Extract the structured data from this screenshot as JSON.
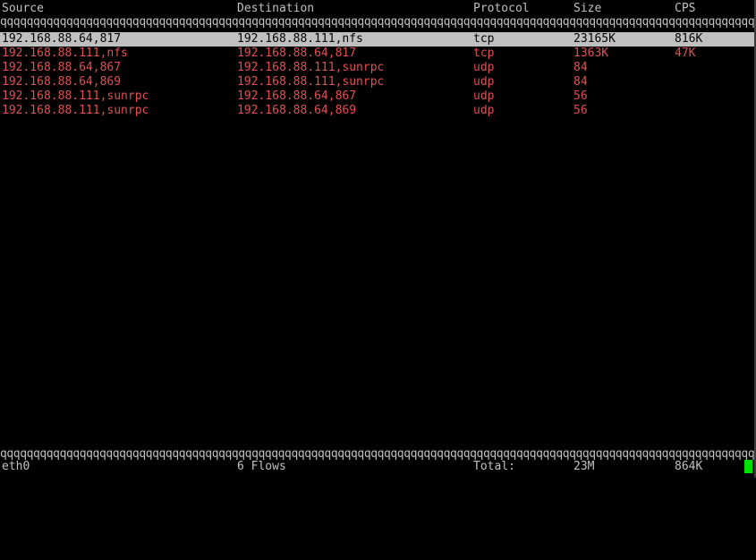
{
  "columns": {
    "source": "Source",
    "destination": "Destination",
    "protocol": "Protocol",
    "size": "Size",
    "cps": "CPS"
  },
  "separator_glyphs": "qqqqqqqqqqqqqqqqqqqqqqqqqqqqqqqqqqqqqqqqqqqqqqqqqqqqqqqqqqqqqqqqqqqqqqqqqqqqqqqqqqqqqqqqqqqqqqqqqqqqqqqqqqqqqqqqqqqqqqqqqqqqqqqqqqqqqqqqqqqq",
  "flows": [
    {
      "source": "192.168.88.64,817",
      "destination": "192.168.88.111,nfs",
      "protocol": "tcp",
      "size": "23165K",
      "cps": "816K",
      "selected": true
    },
    {
      "source": "192.168.88.111,nfs",
      "destination": "192.168.88.64,817",
      "protocol": "tcp",
      "size": "1363K",
      "cps": "47K",
      "selected": false
    },
    {
      "source": "192.168.88.64,867",
      "destination": "192.168.88.111,sunrpc",
      "protocol": "udp",
      "size": "84",
      "cps": "",
      "selected": false
    },
    {
      "source": "192.168.88.64,869",
      "destination": "192.168.88.111,sunrpc",
      "protocol": "udp",
      "size": "84",
      "cps": "",
      "selected": false
    },
    {
      "source": "192.168.88.111,sunrpc",
      "destination": "192.168.88.64,867",
      "protocol": "udp",
      "size": "56",
      "cps": "",
      "selected": false
    },
    {
      "source": "192.168.88.111,sunrpc",
      "destination": "192.168.88.64,869",
      "protocol": "udp",
      "size": "56",
      "cps": "",
      "selected": false
    }
  ],
  "footer": {
    "interface": "eth0",
    "flows": "6 Flows",
    "total_label": "Total:",
    "total_size": "23M",
    "total_cps": "864K"
  },
  "colors": {
    "background": "#000000",
    "text": "#c0c0c0",
    "flow_text": "#e05050",
    "selected_bg": "#c0c0c0",
    "cursor": "#00e000"
  }
}
